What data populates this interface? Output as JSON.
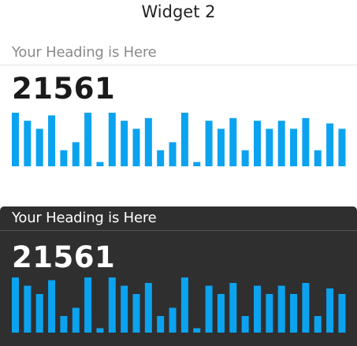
{
  "page": {
    "title": "Widget 2"
  },
  "colors": {
    "bar": "#0ba3ef",
    "dark_bg": "#2f2f2f",
    "light_bg": "#ffffff"
  },
  "widgets": [
    {
      "theme": "light",
      "heading": "Your Heading is Here",
      "value": "21561"
    },
    {
      "theme": "dark",
      "heading": "Your Heading is Here",
      "value": "21561"
    }
  ],
  "chart_data": [
    {
      "type": "bar",
      "title": "",
      "values": [
        10,
        8.5,
        7,
        9.5,
        3,
        4.5,
        10,
        0.8,
        10,
        8.5,
        7,
        9,
        3,
        4.5,
        10,
        0.8,
        8.5,
        7,
        9,
        3,
        8.5,
        7,
        8.5,
        7,
        9,
        3,
        8,
        7
      ],
      "ylim": [
        0,
        10
      ]
    },
    {
      "type": "bar",
      "title": "",
      "values": [
        10,
        8.5,
        7,
        9.5,
        3,
        4.5,
        10,
        0.8,
        10,
        8.5,
        7,
        9,
        3,
        4.5,
        10,
        0.8,
        8.5,
        7,
        9,
        3,
        8.5,
        7,
        8.5,
        7,
        9,
        3,
        8,
        7
      ],
      "ylim": [
        0,
        10
      ]
    }
  ]
}
